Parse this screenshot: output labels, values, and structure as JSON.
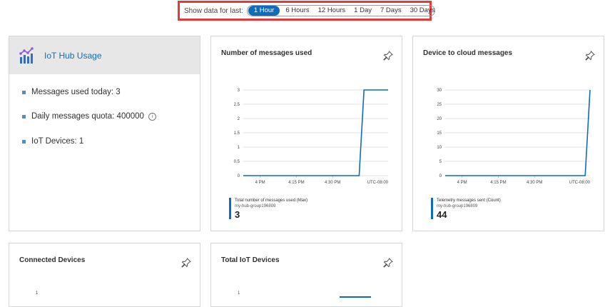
{
  "time_filter": {
    "label": "Show data for last:",
    "options": [
      "1 Hour",
      "6 Hours",
      "12 Hours",
      "1 Day",
      "7 Days",
      "30 Days"
    ],
    "selected": "1 Hour"
  },
  "usage": {
    "title": "IoT Hub Usage",
    "stats": [
      {
        "label": "Messages used today:",
        "value": "3"
      },
      {
        "label": "Daily messages quota:",
        "value": "400000"
      },
      {
        "label": "IoT Devices:",
        "value": "1"
      }
    ]
  },
  "tiles": {
    "messages_used": {
      "title": "Number of messages used"
    },
    "d2c": {
      "title": "Device to cloud messages"
    },
    "connected": {
      "title": "Connected Devices"
    },
    "total": {
      "title": "Total IoT Devices"
    }
  },
  "chart_data": [
    {
      "type": "line",
      "title": "Number of messages used",
      "x_ticks": [
        "4 PM",
        "4:15 PM",
        "4:30 PM"
      ],
      "timezone": "UTC-08:00",
      "y_ticks": [
        "0",
        "0.5",
        "1",
        "1.5",
        "2",
        "2.5",
        "3"
      ],
      "ylim": [
        0,
        3
      ],
      "grid": true,
      "series": [
        {
          "name": "Total number of messages used (Max)",
          "resource": "my-hub-group196809",
          "x": [
            "3:53 PM",
            "4:41 PM",
            "4:43 PM",
            "4:53 PM"
          ],
          "y": [
            0,
            0,
            3,
            3
          ]
        }
      ],
      "summary_value": "3",
      "color": "#0f6cbd"
    },
    {
      "type": "line",
      "title": "Device to cloud messages",
      "x_ticks": [
        "4 PM",
        "4:15 PM",
        "4:30 PM"
      ],
      "timezone": "UTC-08:00",
      "y_ticks": [
        "0",
        "5",
        "10",
        "15",
        "20",
        "25",
        "30"
      ],
      "ylim": [
        0,
        30
      ],
      "grid": true,
      "series": [
        {
          "name": "Telemetry messages sent (Count)",
          "resource": "my-hub-group196809",
          "x": [
            "3:53 PM",
            "4:51 PM",
            "4:53 PM"
          ],
          "y": [
            0,
            0,
            30
          ]
        }
      ],
      "summary_value": "44",
      "color": "#0f6cbd"
    }
  ],
  "partial_charts": {
    "connected_y_top": "1",
    "total_y_top": "1"
  }
}
